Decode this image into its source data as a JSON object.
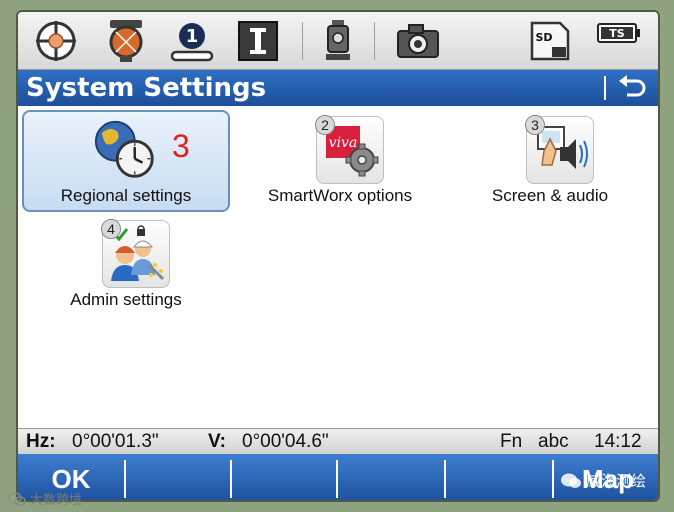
{
  "title": "System Settings",
  "top_icons": [
    "target-icon",
    "prism-icon",
    "job-1-icon",
    "instrument-i-icon",
    "total-station-icon",
    "camera-icon",
    "sd-card-icon",
    "ts-battery-icon"
  ],
  "job_number": "1",
  "ts_label": "TS",
  "sd_label": "SD",
  "tiles": [
    {
      "num": "",
      "label": "Regional settings",
      "icon": "globe-clock-icon",
      "badge": "3"
    },
    {
      "num": "2",
      "label": "SmartWorx options",
      "icon": "smartworx-gear-icon",
      "logo_text": "viva"
    },
    {
      "num": "3",
      "label": "Screen & audio",
      "icon": "screen-audio-icon"
    },
    {
      "num": "4",
      "label": "Admin settings",
      "icon": "admin-users-icon"
    }
  ],
  "status": {
    "hz_label": "Hz:",
    "hz_value": "0°00'01.3\"",
    "v_label": "V:",
    "v_value": "0°00'04.6\"",
    "fn": "Fn",
    "mode": "abc",
    "time": "14:12"
  },
  "softkeys": {
    "ok": "OK",
    "map": "Map"
  },
  "watermarks": {
    "left": "大数跨境",
    "right": "威海测绘"
  },
  "colors": {
    "title_bar": "#1d4f9a",
    "accent_red": "#e02020",
    "selection": "#c7dcf2"
  }
}
